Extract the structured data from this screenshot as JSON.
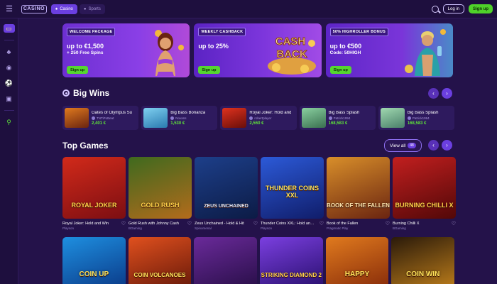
{
  "topbar": {
    "logo": "CASINO",
    "tabs": [
      {
        "label": "Casino",
        "active": true
      },
      {
        "label": "Sports",
        "active": false
      }
    ],
    "login": "Log in",
    "signup": "Sign up"
  },
  "banners": [
    {
      "tag": "WELCOME PACKAGE",
      "line1": "up to €1,500",
      "line2": "+ 250 Free Spins",
      "button": "Sign up"
    },
    {
      "tag": "WEEKLY CASHBACK",
      "line1": "up to 25%",
      "line2": "",
      "button": "Sign up",
      "art_text": "CASH BACK"
    },
    {
      "tag": "50% HIGHROLLER BONUS",
      "line1": "up to €500",
      "line2": "Code: 50HIGH",
      "button": "Sign up"
    }
  ],
  "bigwins": {
    "title": "Big Wins",
    "items": [
      {
        "game": "Gates of Olympus Su",
        "player": "TNTiPoBeat",
        "amount": "2,401 €",
        "thumb": "#c05a1e"
      },
      {
        "game": "Big Bass Bonanza",
        "player": "Novans",
        "amount": "1,530 €",
        "thumb": "#3fa0d8"
      },
      {
        "game": "Royal Joker: Hold and",
        "player": "robertplayer",
        "amount": "2,560 €",
        "thumb": "#b8251f"
      },
      {
        "game": "Big Bass Splash",
        "player": "Patrick1994",
        "amount": "168,583 €",
        "thumb": "#5aa070"
      },
      {
        "game": "Big Bass Splash",
        "player": "Patrick1994",
        "amount": "168,583 €",
        "thumb": "#6aa88a"
      }
    ]
  },
  "topgames": {
    "title": "Top Games",
    "view_all": "View all",
    "count": "48",
    "row1": [
      {
        "art": "ROYAL JOKER",
        "name": "Royal Joker: Hold and Win",
        "provider": "Playson",
        "bg": "linear-gradient(160deg,#d22a1a,#7c0e12)"
      },
      {
        "art": "GOLD RUSH",
        "name": "Gold Rush with Johnny Cash",
        "provider": "BGaming",
        "bg": "linear-gradient(160deg,#b36b1c,#3e6a1e)"
      },
      {
        "art": "ZEUS UNCHAINED",
        "name": "Zeus Unchained - Hold & Hit",
        "provider": "Spinomenal",
        "bg": "linear-gradient(160deg,#1d3f8a,#0c1b45)"
      },
      {
        "art": "THUNDER COINS XXL",
        "name": "Thunder Coins XXL: Hold and Win",
        "provider": "Playson",
        "bg": "linear-gradient(160deg,#2c5ad8,#101d6a)"
      },
      {
        "art": "BOOK OF THE FALLEN",
        "name": "Book of the Fallen",
        "provider": "Pragmatic Play",
        "bg": "linear-gradient(160deg,#d98f2a,#6a2410)"
      },
      {
        "art": "BURNING CHILLI X",
        "name": "Burning Chilli X",
        "provider": "BGaming",
        "bg": "linear-gradient(160deg,#c21f1f,#520808)"
      }
    ],
    "row2": [
      {
        "art": "COIN UP",
        "bg": "linear-gradient(160deg,#1e8fe0,#0b3c8a)"
      },
      {
        "art": "COIN VOLCANOES",
        "bg": "linear-gradient(160deg,#e0501e,#6a1a0a)"
      },
      {
        "art": "",
        "bg": "linear-gradient(160deg,#6a2a9a,#2a0f4a)"
      },
      {
        "art": "STRIKING DIAMOND 2",
        "bg": "linear-gradient(160deg,#7b3fe0,#2a1070)"
      },
      {
        "art": "HAPPY",
        "bg": "linear-gradient(160deg,#e07a1e,#8a2e0a)"
      },
      {
        "art": "COIN WIN",
        "bg": "linear-gradient(160deg,#2a1a0a,#b87a1a)"
      }
    ]
  }
}
